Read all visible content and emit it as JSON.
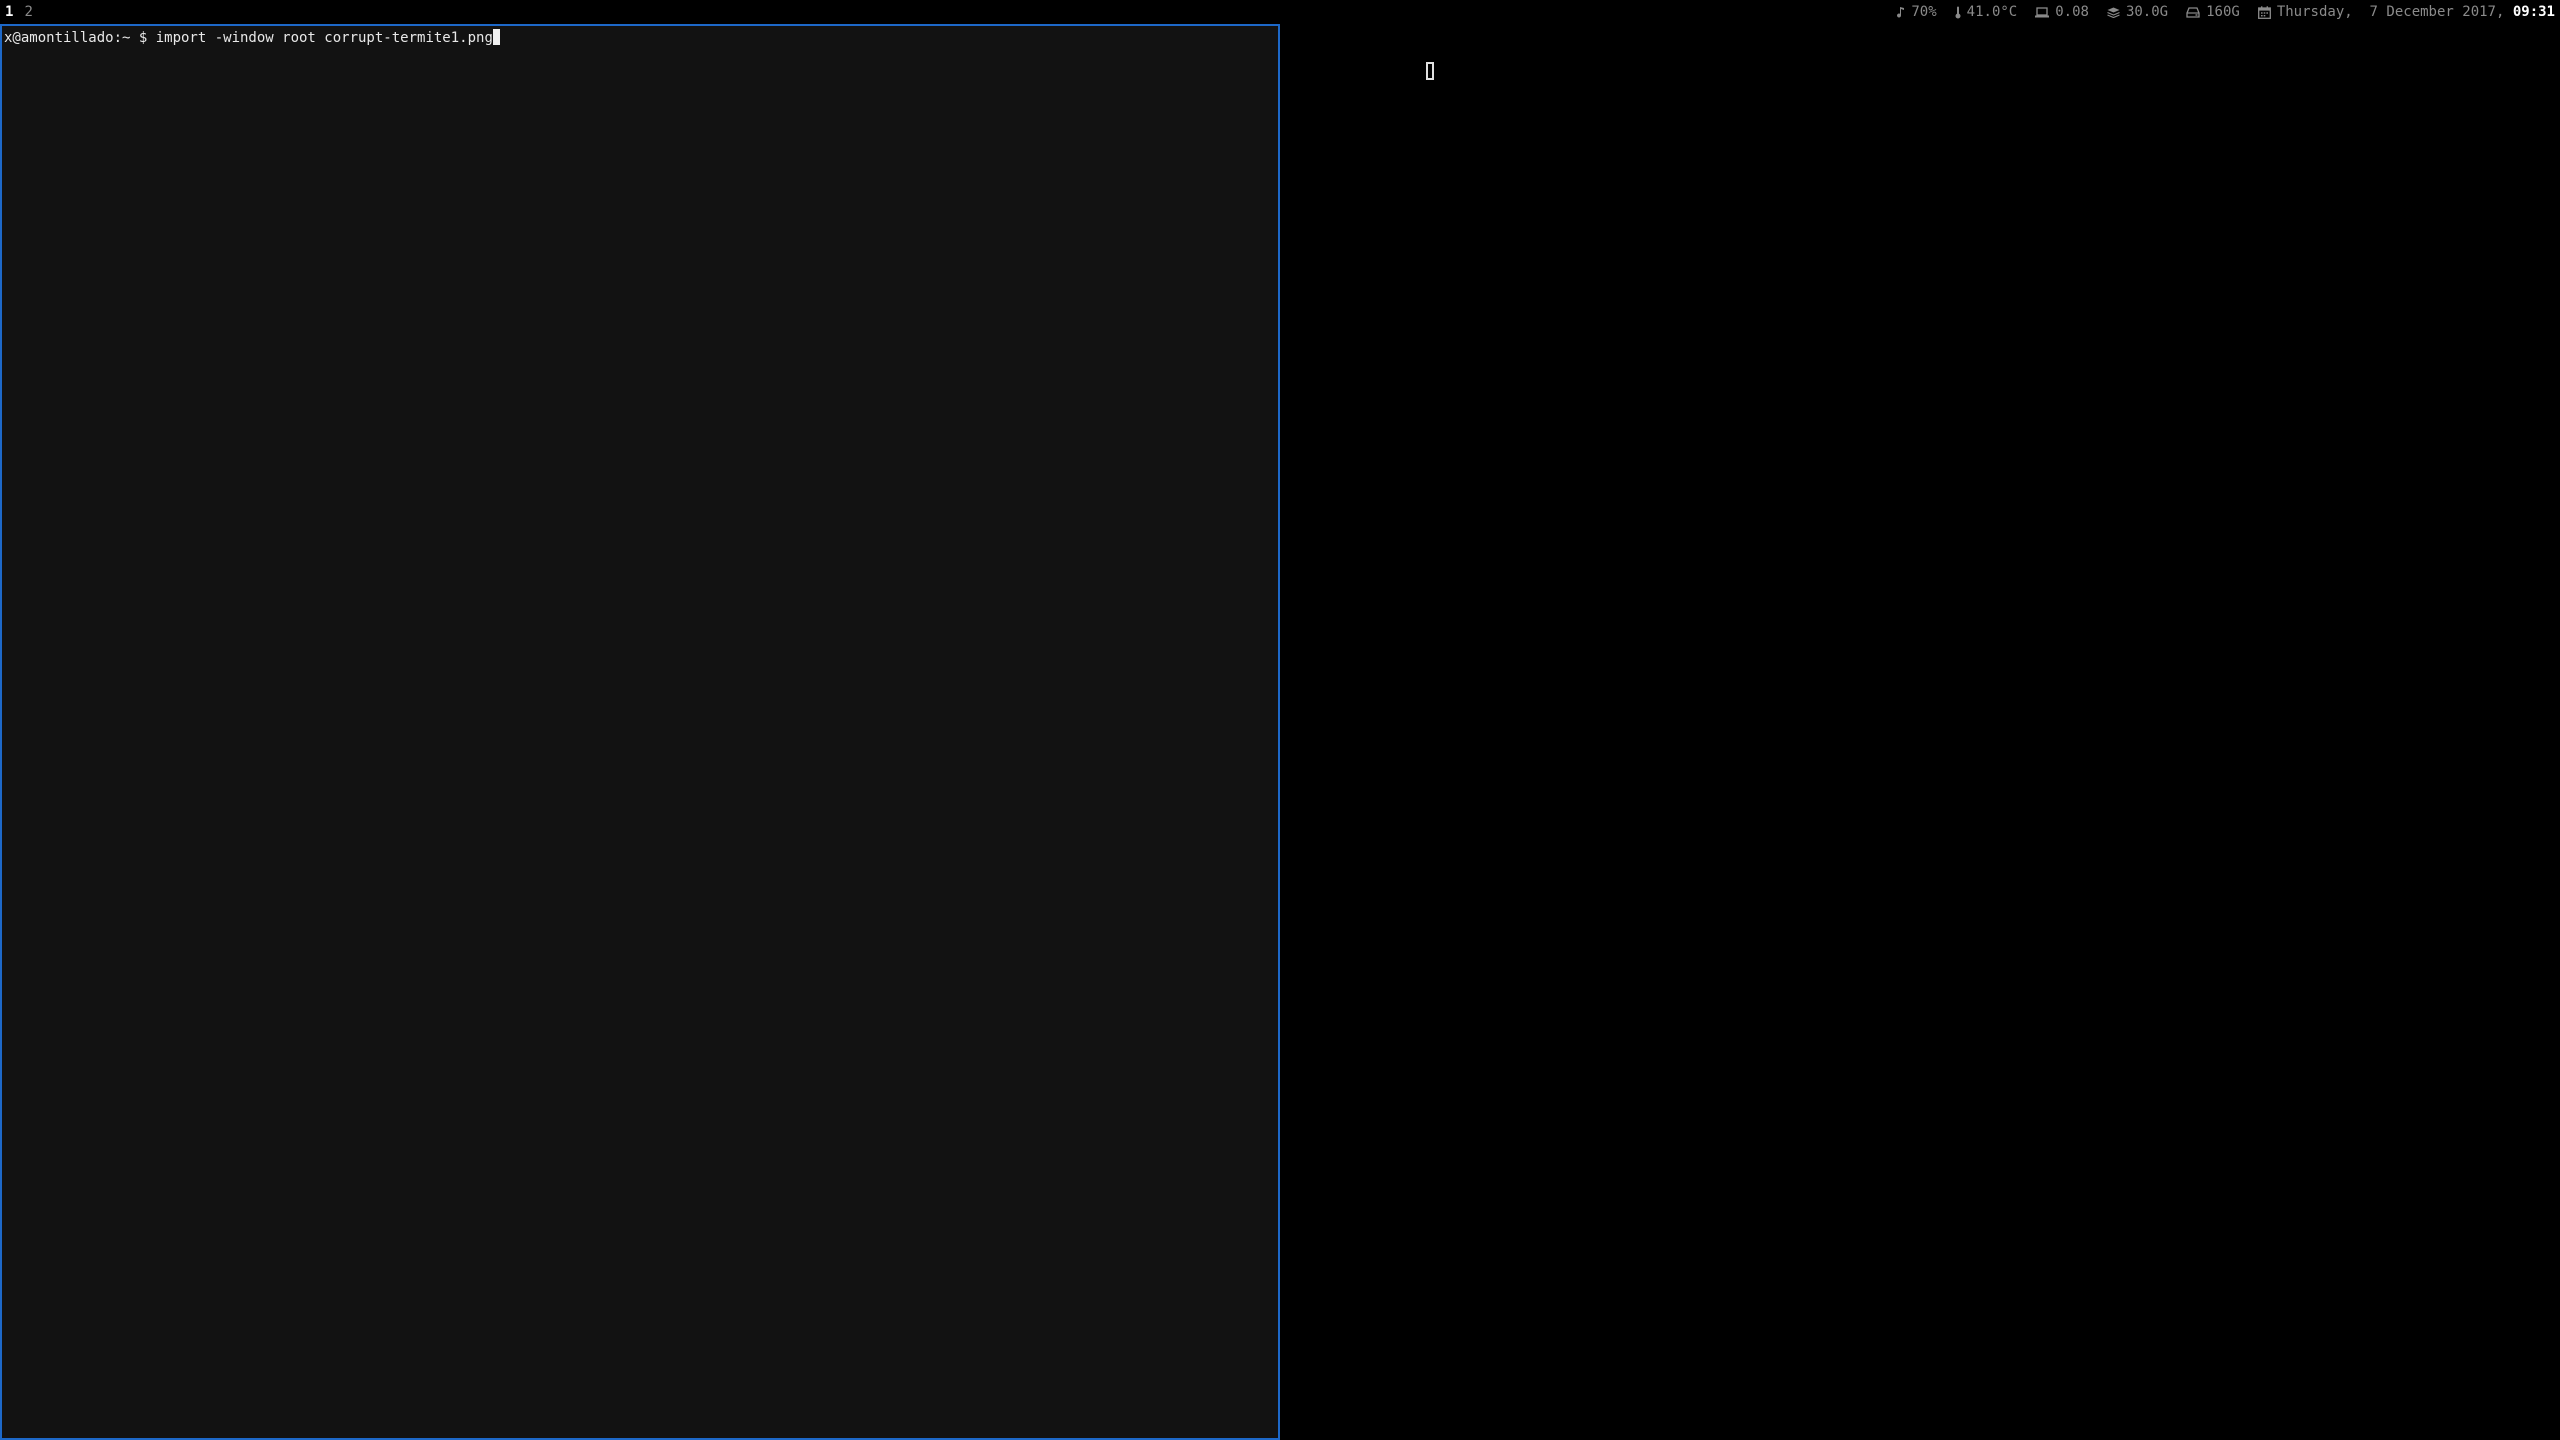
{
  "topbar": {
    "workspaces": [
      {
        "label": "1",
        "active": true
      },
      {
        "label": "2",
        "active": false
      }
    ],
    "status": {
      "volume": {
        "icon": "music-note-icon",
        "value": "70%"
      },
      "temperature": {
        "icon": "thermometer-icon",
        "value": "41.0°C"
      },
      "load": {
        "icon": "laptop-icon",
        "value": "0.08"
      },
      "memory": {
        "icon": "memory-layers-icon",
        "value": "30.0G"
      },
      "disk": {
        "icon": "hard-drive-icon",
        "value": "160G"
      },
      "clock": {
        "icon": "calendar-icon",
        "date": "Thursday,  7 December 2017,",
        "time": "09:31"
      }
    }
  },
  "terminal": {
    "prompt": "x@amontillado:~ $ ",
    "command": "import -window root corrupt-termite1.png"
  },
  "colors": {
    "background": "#000000",
    "terminal_bg": "#121212",
    "focus_border": "#1d68c8",
    "status_text": "#8a8a8a",
    "highlight_text": "#ffffff"
  }
}
